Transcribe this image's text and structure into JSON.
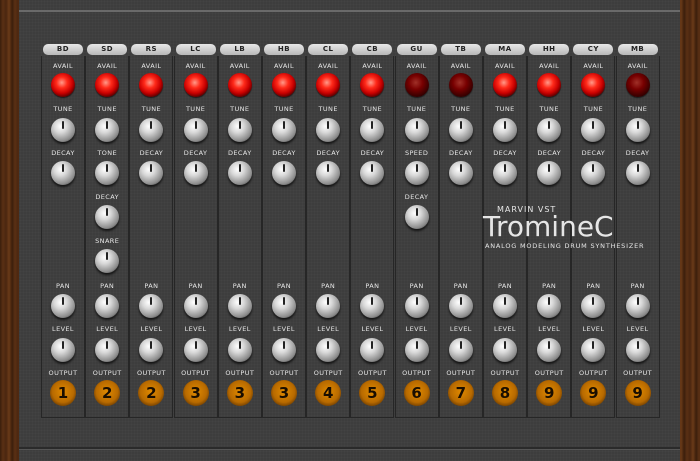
{
  "labels": {
    "avail": "AVAIL",
    "tune": "TUNE",
    "decay": "DECAY",
    "tone": "TONE",
    "snare": "SNARE",
    "speed": "SPEED",
    "pan": "PAN",
    "level": "LEVEL",
    "output": "OUTPUT"
  },
  "channels": [
    {
      "name": "BD",
      "output": "1",
      "avail_lit": true
    },
    {
      "name": "SD",
      "output": "2",
      "avail_lit": true
    },
    {
      "name": "RS",
      "output": "2",
      "avail_lit": true
    },
    {
      "name": "LC",
      "output": "3",
      "avail_lit": true
    },
    {
      "name": "LB",
      "output": "3",
      "avail_lit": true
    },
    {
      "name": "HB",
      "output": "3",
      "avail_lit": true
    },
    {
      "name": "CL",
      "output": "4",
      "avail_lit": true
    },
    {
      "name": "CB",
      "output": "5",
      "avail_lit": true
    },
    {
      "name": "GU",
      "output": "6",
      "avail_lit": false
    },
    {
      "name": "TB",
      "output": "7",
      "avail_lit": false
    },
    {
      "name": "MA",
      "output": "8",
      "avail_lit": true
    },
    {
      "name": "HH",
      "output": "9",
      "avail_lit": true
    },
    {
      "name": "CY",
      "output": "9",
      "avail_lit": true
    },
    {
      "name": "MB",
      "output": "9",
      "avail_lit": false
    }
  ],
  "logo": {
    "brand": "MARVIN VST",
    "title": "TromineC",
    "subtitle": "ANALOG MODELING DRUM SYNTHESIZER"
  },
  "colors": {
    "panel": "#3d3d3d",
    "led_on": "#ff2a1a",
    "led_off": "#780000",
    "output_amber": "#e08a00",
    "wood": "#5a3014"
  }
}
